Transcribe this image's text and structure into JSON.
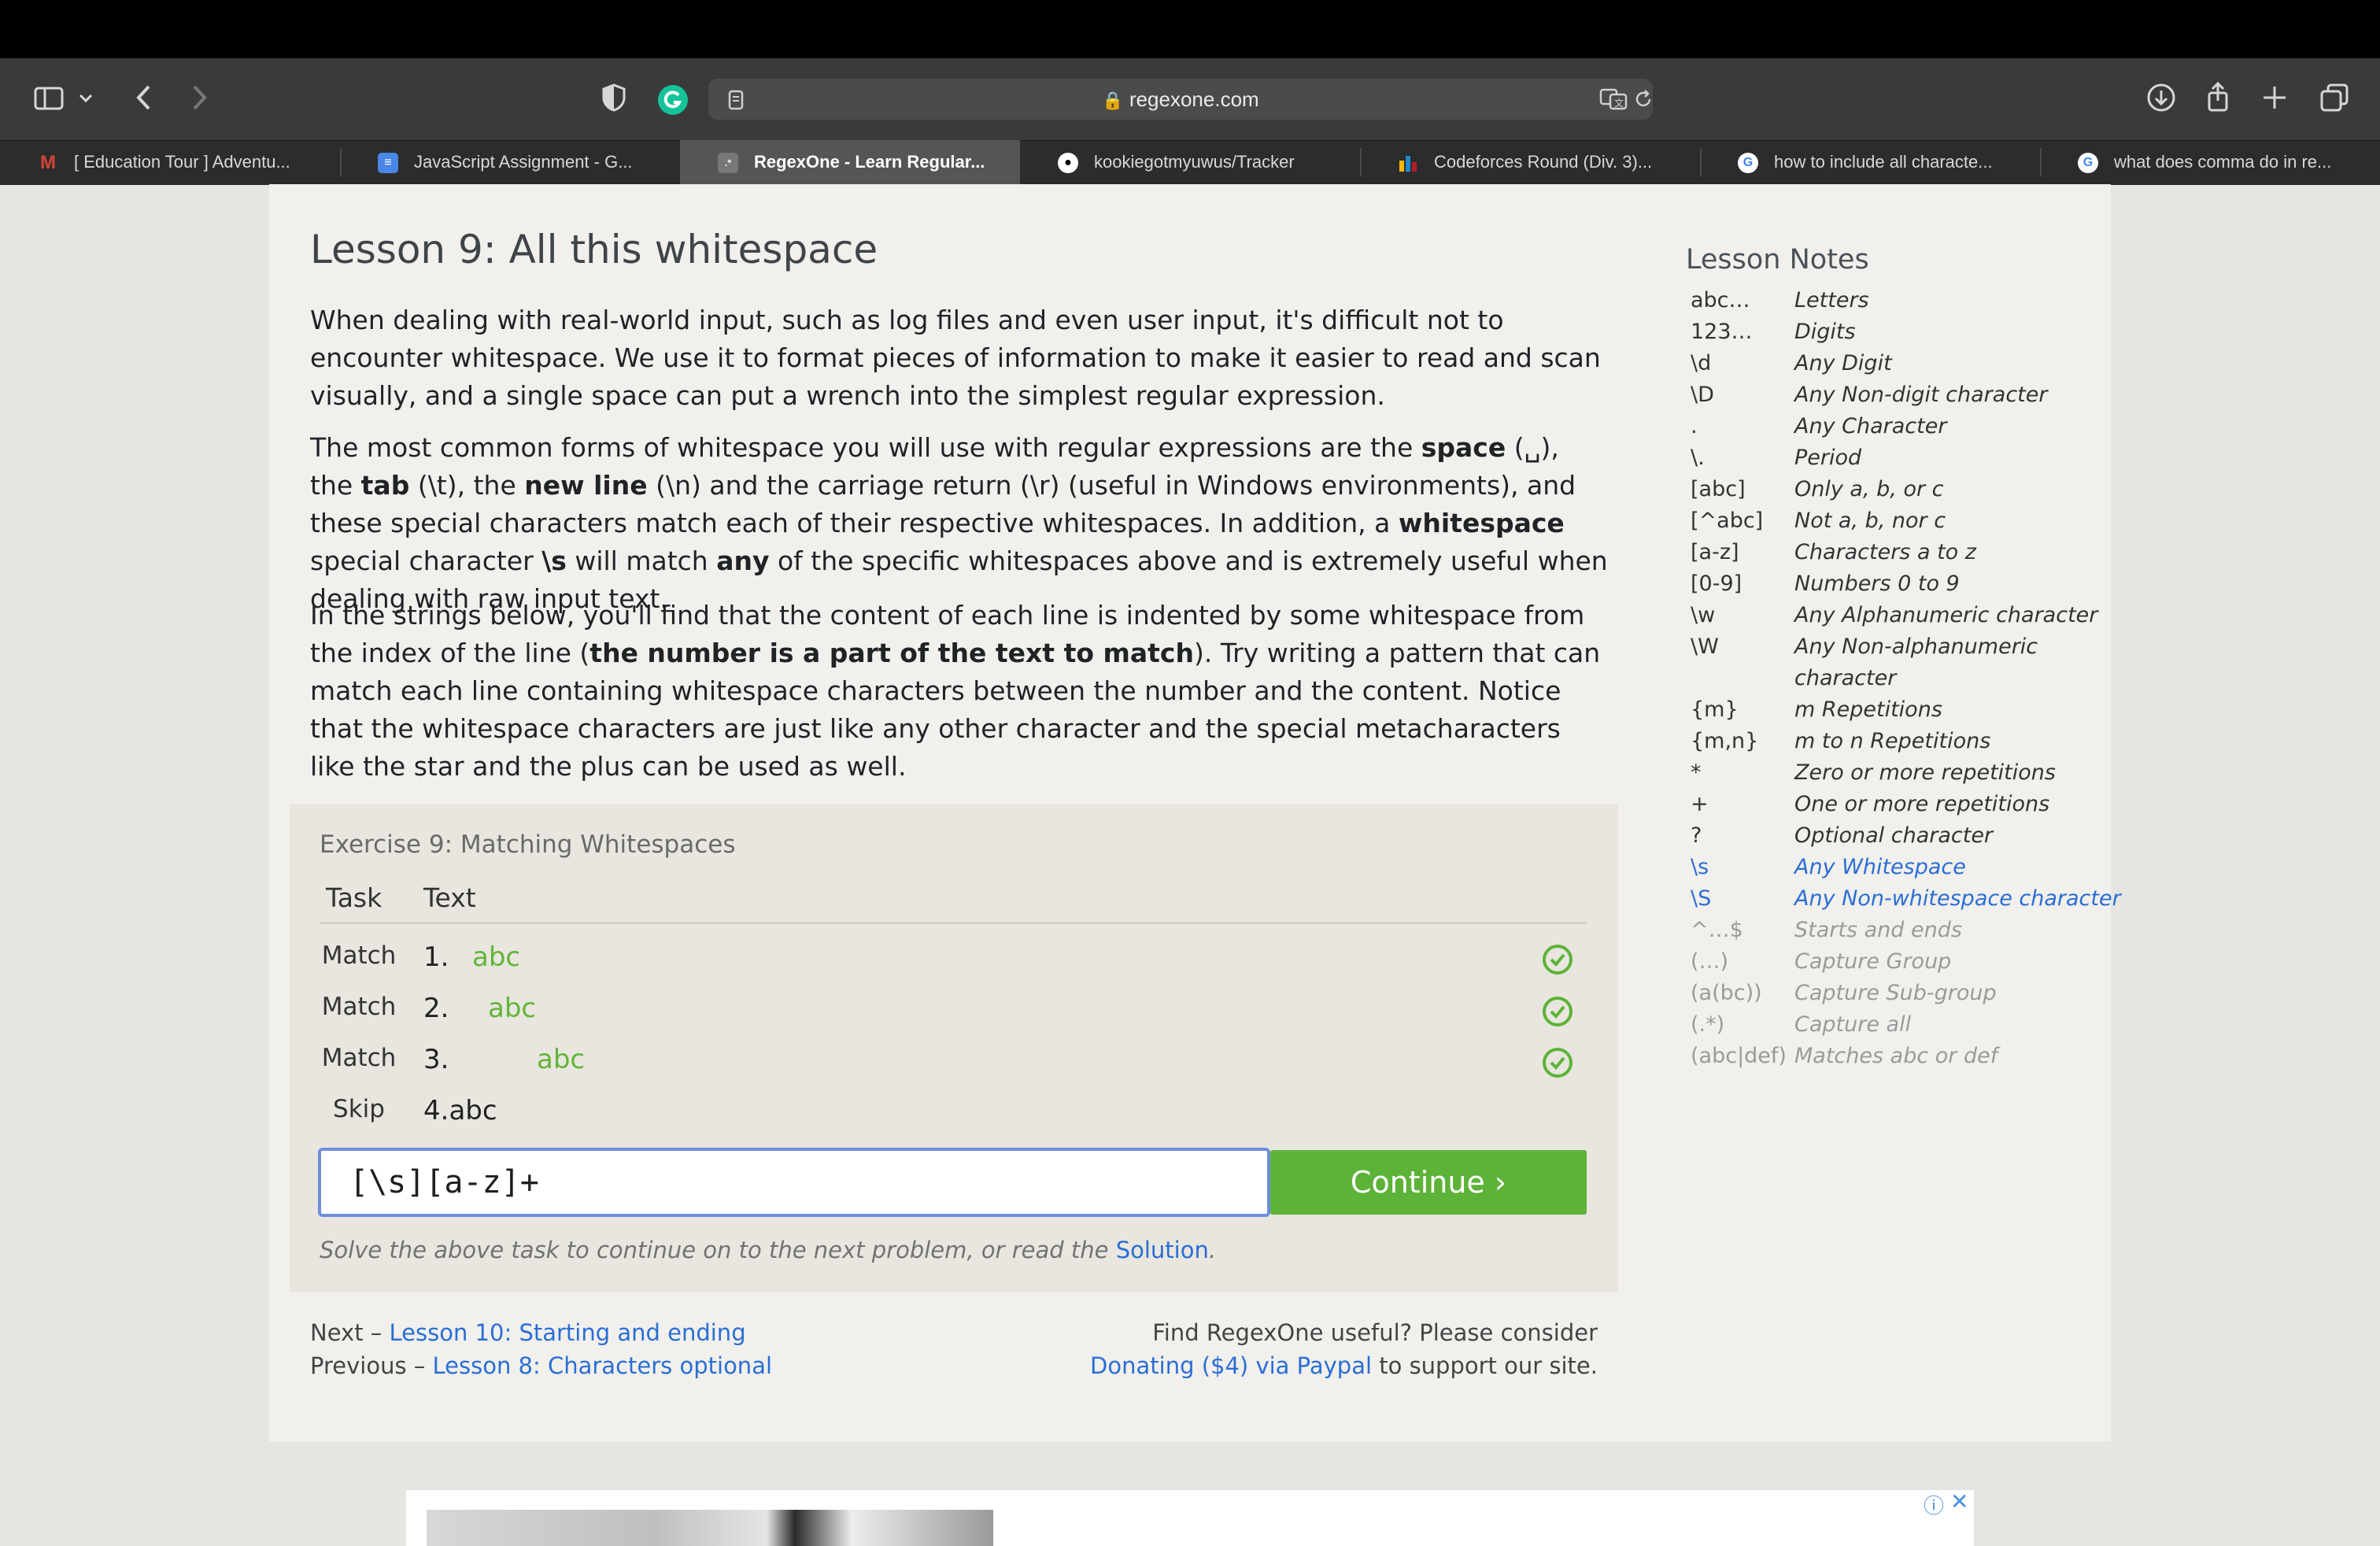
{
  "browser": {
    "url": "regexone.com",
    "tabs": [
      {
        "label": "[ Education Tour ] Adventu...",
        "icon": "gmail-icon",
        "color": "#d44638"
      },
      {
        "label": "JavaScript Assignment - G...",
        "icon": "google-docs-icon",
        "color": "#4a86e8"
      },
      {
        "label": "RegexOne - Learn Regular...",
        "icon": "regexone-icon",
        "color": "#777777",
        "active": true
      },
      {
        "label": "kookiegotmyuwus/Tracker",
        "icon": "github-icon",
        "color": "#ffffff"
      },
      {
        "label": "Codeforces Round (Div. 3)...",
        "icon": "codeforces-icon",
        "color": "#f5b800"
      },
      {
        "label": "how to include all characte...",
        "icon": "google-icon",
        "color": "#ffffff"
      },
      {
        "label": "what does comma do in re...",
        "icon": "google-icon",
        "color": "#ffffff"
      }
    ]
  },
  "lesson": {
    "title": "Lesson 9: All this whitespace",
    "p1": "When dealing with real-world input, such as log files and even user input, it's difficult not to encounter whitespace. We use it to format pieces of information to make it easier to read and scan visually, and a single space can put a wrench into the simplest regular expression.",
    "p2": {
      "a": "The most common forms of whitespace you will use with regular expressions are the ",
      "b": "space",
      "c": " (␣), the ",
      "d": "tab",
      "e": " (\\t), the ",
      "f": "new line",
      "g": " (\\n) and the carriage return (\\r) (useful in Windows environments), and these special characters match each of their respective whitespaces. In addition, a ",
      "h": "whitespace",
      "i": " special character ",
      "j": "\\s",
      "k": " will match ",
      "l": "any",
      "m": " of the specific whitespaces above and is extremely useful when dealing with raw input text."
    },
    "p3": {
      "a": "In the strings below, you'll find that the content of each line is indented by some whitespace from the index of the line (",
      "b": "the number is a part of the text to match",
      "c": "). Try writing a pattern that can match each line containing whitespace characters between the number and the content. Notice that the whitespace characters are just like any other character and the special metacharacters like the star and the plus can be used as well."
    }
  },
  "exercise": {
    "title": "Exercise 9: Matching Whitespaces",
    "col_task": "Task",
    "col_text": "Text",
    "rows": [
      {
        "task": "Match",
        "num": "1.",
        "text": "abc",
        "status": "matched"
      },
      {
        "task": "Match",
        "num": "2.",
        "text": "abc",
        "status": "matched"
      },
      {
        "task": "Match",
        "num": "3.",
        "text": "abc",
        "status": "matched"
      },
      {
        "task": "Skip",
        "num": "4.abc",
        "text": "",
        "status": "none"
      }
    ],
    "input_value": "[\\s][a-z]+",
    "continue_label": "Continue ›",
    "hint_prefix": "Solve the above task to continue on to the next problem, or read the ",
    "hint_link": "Solution",
    "hint_suffix": "."
  },
  "nav": {
    "next_prefix": "Next – ",
    "next_link": "Lesson 10: Starting and ending",
    "prev_prefix": "Previous – ",
    "prev_link": "Lesson 8: Characters optional",
    "donate_line1": "Find RegexOne useful? Please consider",
    "donate_link": "Donating ($4) via Paypal",
    "donate_suffix": " to support our site."
  },
  "notes": {
    "title": "Lesson Notes",
    "items": [
      {
        "k": "abc…",
        "v": "Letters",
        "style": "normal"
      },
      {
        "k": "123…",
        "v": "Digits",
        "style": "normal"
      },
      {
        "k": "\\d",
        "v": "Any Digit",
        "style": "normal"
      },
      {
        "k": "\\D",
        "v": "Any Non-digit character",
        "style": "normal"
      },
      {
        "k": ".",
        "v": "Any Character",
        "style": "normal"
      },
      {
        "k": "\\.",
        "v": "Period",
        "style": "normal"
      },
      {
        "k": "[abc]",
        "v": "Only a, b, or c",
        "style": "normal"
      },
      {
        "k": "[^abc]",
        "v": "Not a, b, nor c",
        "style": "normal"
      },
      {
        "k": "[a-z]",
        "v": "Characters a to z",
        "style": "normal"
      },
      {
        "k": "[0-9]",
        "v": "Numbers 0 to 9",
        "style": "normal"
      },
      {
        "k": "\\w",
        "v": "Any Alphanumeric character",
        "style": "normal"
      },
      {
        "k": "\\W",
        "v": "Any Non-alphanumeric",
        "style": "normal"
      },
      {
        "k": "",
        "v": "character",
        "style": "normal"
      },
      {
        "k": "{m}",
        "v": "m Repetitions",
        "style": "normal"
      },
      {
        "k": "{m,n}",
        "v": "m to n Repetitions",
        "style": "normal"
      },
      {
        "k": "*",
        "v": "Zero or more repetitions",
        "style": "normal"
      },
      {
        "k": "+",
        "v": "One or more repetitions",
        "style": "normal"
      },
      {
        "k": "?",
        "v": "Optional character",
        "style": "normal"
      },
      {
        "k": "\\s",
        "v": "Any Whitespace",
        "style": "blue"
      },
      {
        "k": "\\S",
        "v": "Any Non-whitespace character",
        "style": "blue"
      },
      {
        "k": "^…$",
        "v": "Starts and ends",
        "style": "dim"
      },
      {
        "k": "(…)",
        "v": "Capture Group",
        "style": "dim"
      },
      {
        "k": "(a(bc))",
        "v": "Capture Sub-group",
        "style": "dim"
      },
      {
        "k": "(.*)",
        "v": "Capture all",
        "style": "dim"
      },
      {
        "k": "(abc|def)",
        "v": "Matches abc or def",
        "style": "dim"
      }
    ]
  },
  "colors": {
    "accent_green": "#5db338",
    "match_green": "#62b53a",
    "link_blue": "#2a6ed5"
  }
}
